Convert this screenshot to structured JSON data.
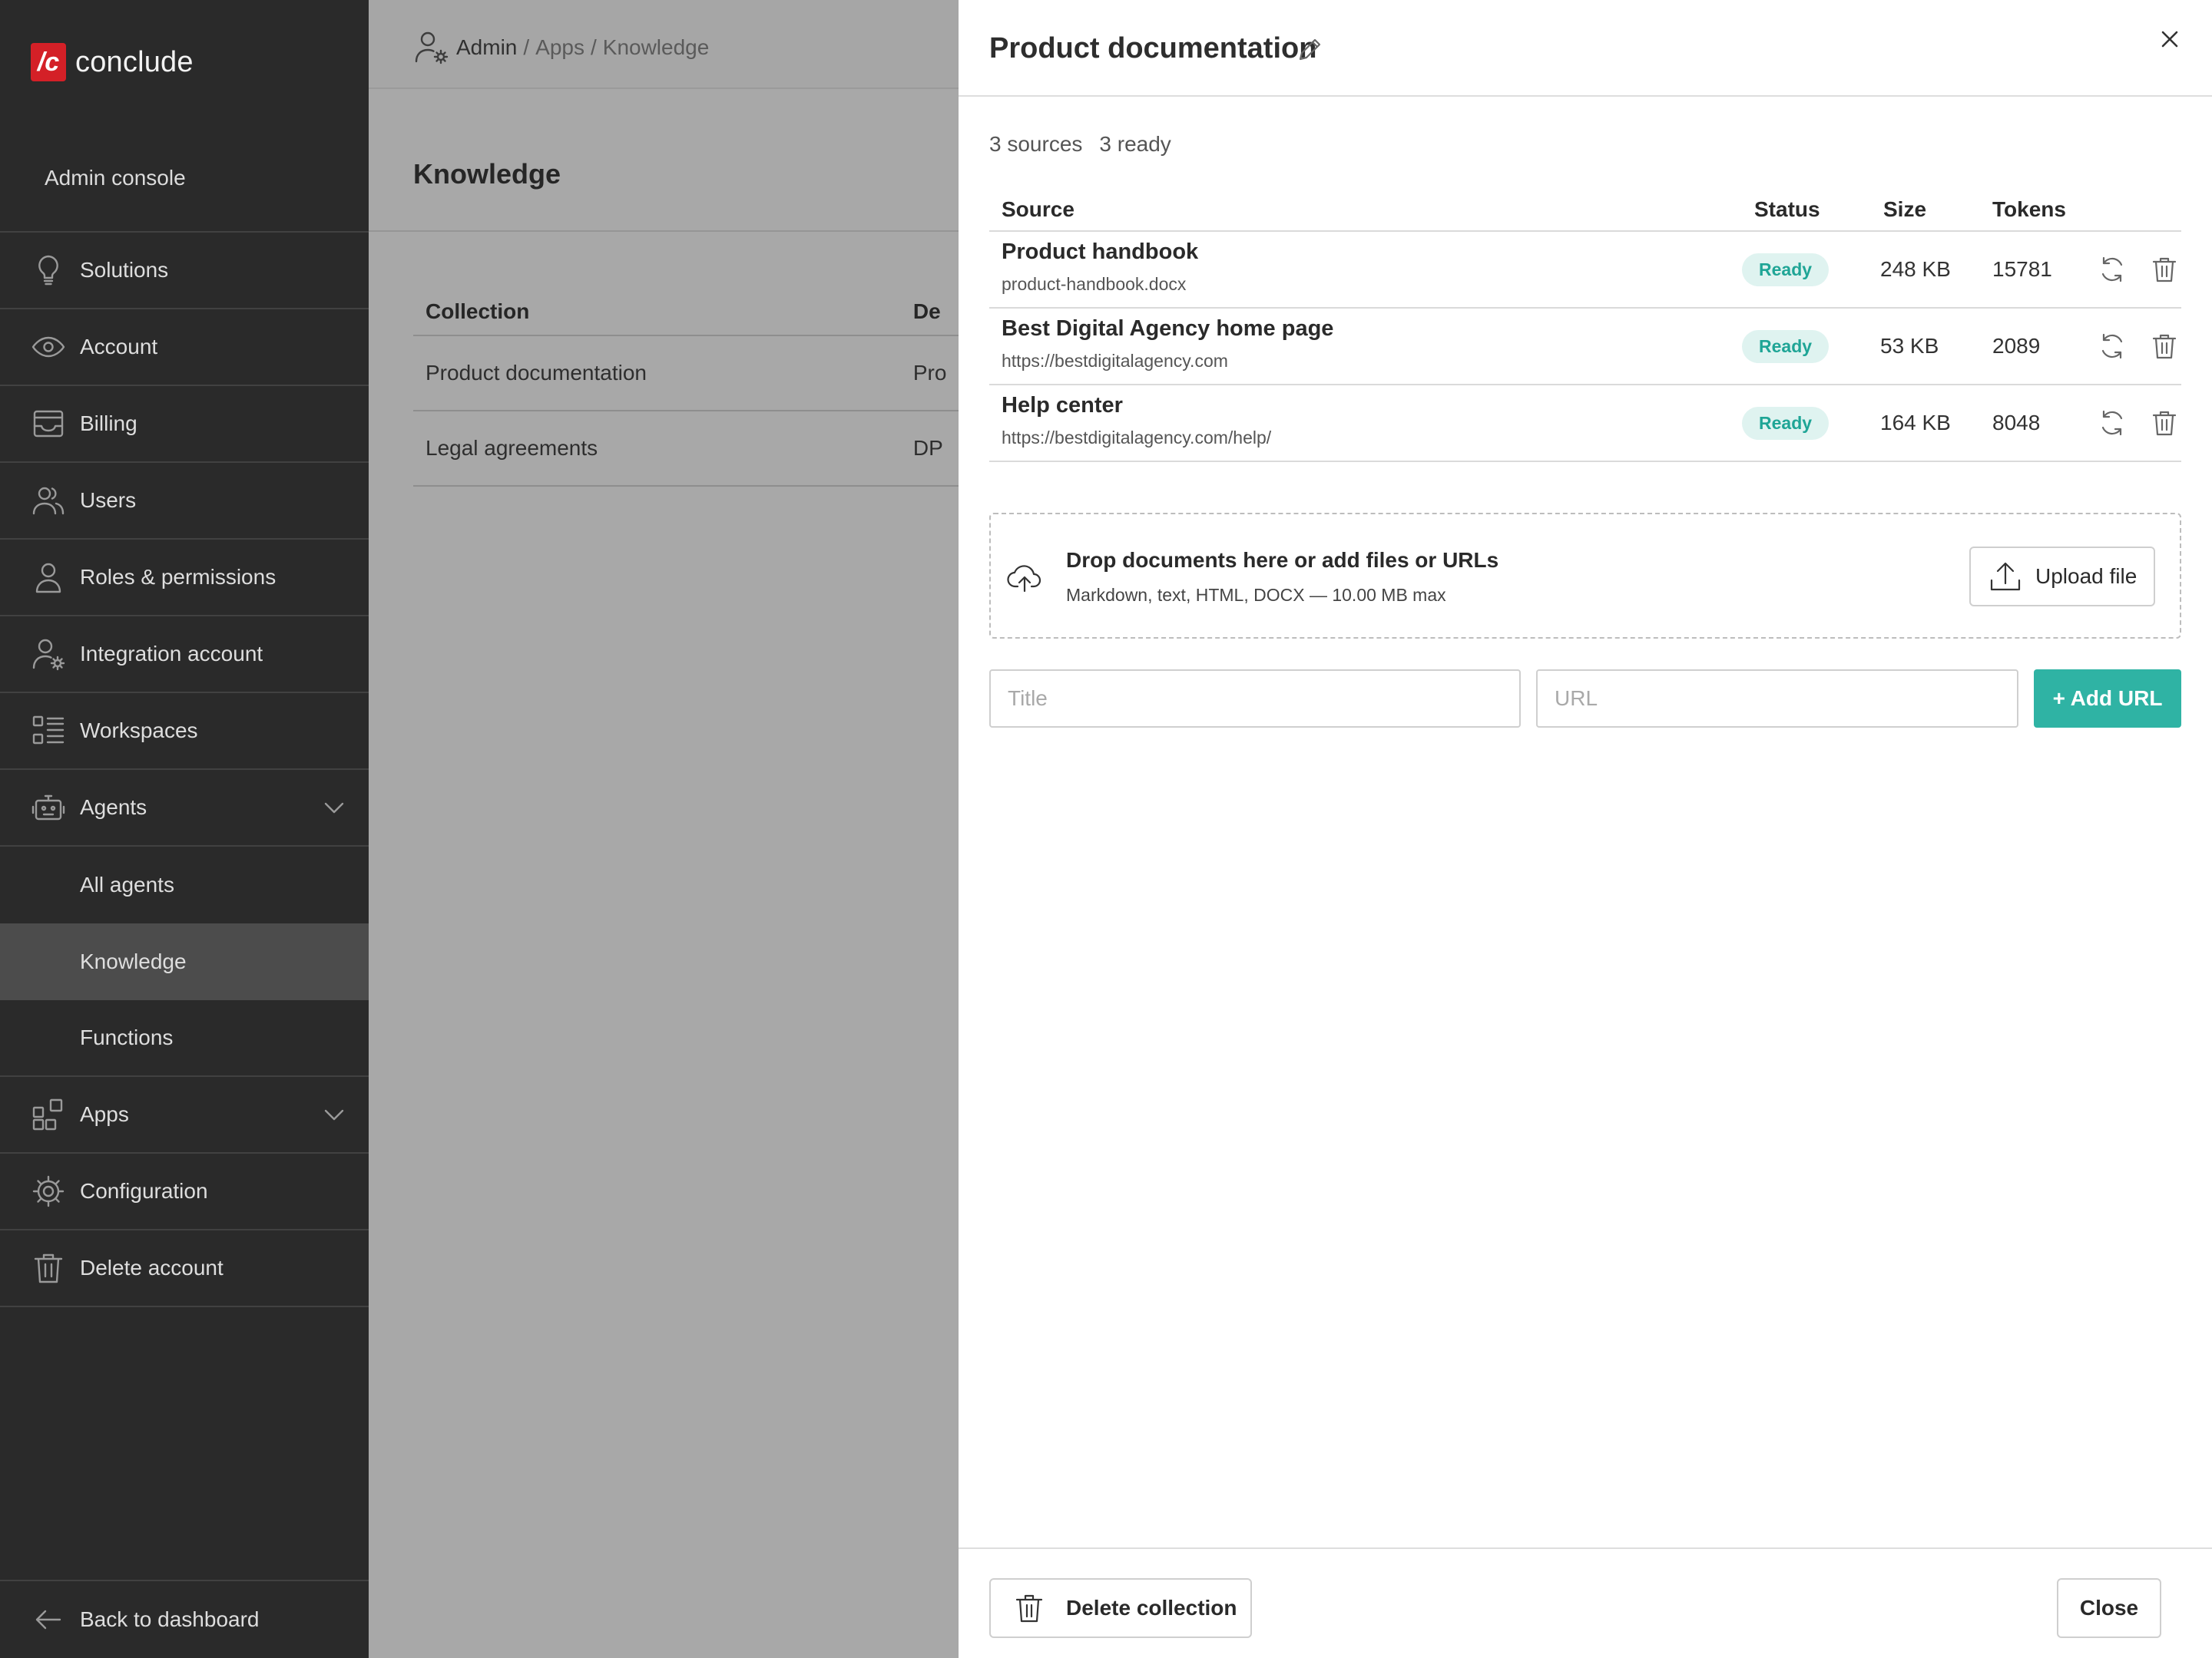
{
  "brand": {
    "logo_mark": "/c",
    "name": "conclude",
    "color": "#d42027"
  },
  "sidebar": {
    "section_label": "Admin console",
    "items": [
      {
        "label": "Solutions",
        "icon": "lightbulb-icon"
      },
      {
        "label": "Account",
        "icon": "eye-icon"
      },
      {
        "label": "Billing",
        "icon": "inbox-icon"
      },
      {
        "label": "Users",
        "icon": "users-icon"
      },
      {
        "label": "Roles & permissions",
        "icon": "user-icon"
      },
      {
        "label": "Integration account",
        "icon": "user-gear-icon"
      },
      {
        "label": "Workspaces",
        "icon": "list-icon"
      },
      {
        "label": "Agents",
        "icon": "robot-icon",
        "expanded": true
      },
      {
        "label": "Apps",
        "icon": "apps-icon",
        "expanded": true
      },
      {
        "label": "Configuration",
        "icon": "gear-icon"
      },
      {
        "label": "Delete account",
        "icon": "trash-icon"
      }
    ],
    "agents_sub": [
      "All agents",
      "Knowledge",
      "Functions"
    ],
    "active_sub": "Knowledge",
    "back_label": "Back to dashboard"
  },
  "breadcrumb": {
    "root": "Admin",
    "path": [
      "Apps",
      "Knowledge"
    ],
    "separator": "/"
  },
  "main": {
    "title": "Knowledge",
    "table": {
      "headers": [
        "Collection",
        "De"
      ],
      "rows": [
        {
          "collection": "Product documentation",
          "desc": "Pro"
        },
        {
          "collection": "Legal agreements",
          "desc": "DP"
        }
      ]
    }
  },
  "drawer": {
    "title": "Product documentation",
    "summary": {
      "sources": "3 sources",
      "ready": "3 ready"
    },
    "headers": {
      "source": "Source",
      "status": "Status",
      "size": "Size",
      "tokens": "Tokens"
    },
    "sources": [
      {
        "name": "Product handbook",
        "detail": "product-handbook.docx",
        "status": "Ready",
        "size": "248 KB",
        "tokens": "15781"
      },
      {
        "name": "Best Digital Agency home page",
        "detail": "https://bestdigitalagency.com",
        "status": "Ready",
        "size": "53 KB",
        "tokens": "2089"
      },
      {
        "name": "Help center",
        "detail": "https://bestdigitalagency.com/help/",
        "status": "Ready",
        "size": "164 KB",
        "tokens": "8048"
      }
    ],
    "dropzone": {
      "title": "Drop documents here or add files or URLs",
      "subtitle": "Markdown, text, HTML, DOCX — 10.00 MB max",
      "upload_label": "Upload file"
    },
    "add_form": {
      "title_placeholder": "Title",
      "url_placeholder": "URL",
      "add_label": "+ Add URL"
    },
    "footer": {
      "delete_label": "Delete collection",
      "close_label": "Close"
    },
    "accent_color": "#2fb3a4"
  }
}
